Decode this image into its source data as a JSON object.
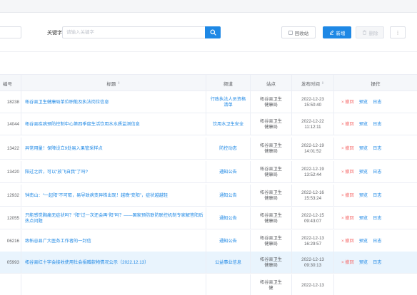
{
  "filter": {
    "keyword_label": "关键字:",
    "keyword_placeholder": "请输入关键字",
    "recycle_label": "回收站",
    "new_label": "新增",
    "delete_label": "删除",
    "more_label": "⋮"
  },
  "colors": {
    "accent": "#1e88e5",
    "danger": "#f56c6c",
    "highlight_row": "#e9f4fd"
  },
  "table": {
    "headers": {
      "id": "编号",
      "title": "标题",
      "channel": "频道",
      "site": "站点",
      "time": "发布时间",
      "ops": "操作"
    },
    "op_labels": {
      "recall": "× 撤回",
      "preview": "预览",
      "log": "日志"
    },
    "rows": [
      {
        "id": "18238",
        "title": "柘谷县卫生健康局单位职能及执法岗位信息",
        "channel": "行政执法人员资格清单",
        "site": "柘谷县卫生健康局",
        "date": "2022-12-23",
        "time": "15:50:40"
      },
      {
        "id": "14044",
        "title": "柘谷县疾病预防控制中心第四季度生活饮用水水质监测信息",
        "channel": "饮用水卫生安全",
        "site": "柘谷县卫生健康局",
        "date": "2022-12-22",
        "time": "11:12:11"
      },
      {
        "id": "13422",
        "title": "异常用量！保障设立9处易入果管采样点",
        "channel": "防控动态",
        "site": "柘谷县卫生健康局",
        "date": "2022-12-19",
        "time": "14:01:52"
      },
      {
        "id": "13420",
        "title": "阳过之后，可以“放飞自我”了吗?",
        "channel": "通知公告",
        "site": "柘谷县卫生健康局",
        "date": "2022-12-19",
        "time": "13:52:44"
      },
      {
        "id": "12932",
        "title": "钟南山：“一起阳”不可取，易导致病变异株出现！越晚“变阳”，症状越越轻",
        "channel": "通知公告",
        "site": "柘谷县卫生健康局",
        "date": "2022-12-16",
        "time": "15:53:24"
      },
      {
        "id": "12055",
        "title": "只能感觉胸痛无症状吗？“阳”过一次还会再“阳”吗？——国家预防联防联控机制专家解答阳后热点问题",
        "channel": "通知公告",
        "site": "柘谷县卫生健康局",
        "date": "2022-12-15",
        "time": "09:43:07"
      },
      {
        "id": "06216",
        "title": "致柘谷县广大医务工作者的一封信",
        "channel": "通知公告",
        "site": "柘谷县卫生健康局",
        "date": "2022-12-13",
        "time": "16:29:57"
      },
      {
        "id": "05993",
        "title": "柘谷县红十字会接收使用社会捐赠款物情况公示（2022.12.13）",
        "channel": "公益事业信息",
        "site": "柘谷县卫生健康局",
        "date": "2022-12-13",
        "time": "09:30:13"
      },
      {
        "id": "",
        "title": "",
        "channel": "",
        "site": "柘谷县卫生健",
        "date": "2022-12-13",
        "time": ""
      }
    ]
  }
}
